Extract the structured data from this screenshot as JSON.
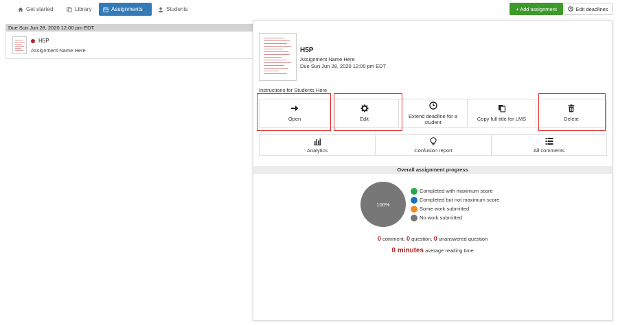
{
  "nav": {
    "tabs": [
      {
        "label": "Get started",
        "icon": "home-icon"
      },
      {
        "label": "Library",
        "icon": "copy-icon"
      },
      {
        "label": "Assignments",
        "icon": "calendar-icon",
        "active": true
      },
      {
        "label": "Students",
        "icon": "user-icon"
      }
    ],
    "add_assignment": "+ Add assignment",
    "edit_deadlines": "Edit deadlines"
  },
  "list": {
    "due_header": "Due Sun Jun 28, 2020 12:00 pm EDT",
    "item": {
      "title": "H5P",
      "subtitle": "Assignment Name Here",
      "status_color": "#b22222"
    }
  },
  "panel": {
    "title": "H5P",
    "name": "Assignment Name Here",
    "due": "Due Sun Jun 28, 2020 12:00 pm EDT",
    "instructions_label": "Instructions for Students Here",
    "actions": {
      "open": "Open",
      "edit": "Edit",
      "extend": "Extend deadline for a student",
      "copy_title": "Copy full title for LMS",
      "delete": "Delete"
    },
    "reports": {
      "analytics": "Analytics",
      "confusion": "Confusion report",
      "comments": "All comments"
    },
    "progress": {
      "heading": "Overall assignment progress",
      "pie_label": "100%",
      "no_work_fraction": 1.0,
      "legend": [
        {
          "label": "Completed with maximum score",
          "color": "#2aa84a"
        },
        {
          "label": "Completed but not maximum score",
          "color": "#1a73b5"
        },
        {
          "label": "Some work submitted",
          "color": "#f08a24"
        },
        {
          "label": "No work submitted",
          "color": "#777777"
        }
      ],
      "stats": {
        "comment_count": "0",
        "comment_label": "comment,",
        "question_count": "0",
        "question_label": "question,",
        "unanswered_count": "0",
        "unanswered_label": "unanswered question"
      },
      "reading": {
        "value": "0 minutes",
        "label": "average reading time"
      }
    }
  }
}
